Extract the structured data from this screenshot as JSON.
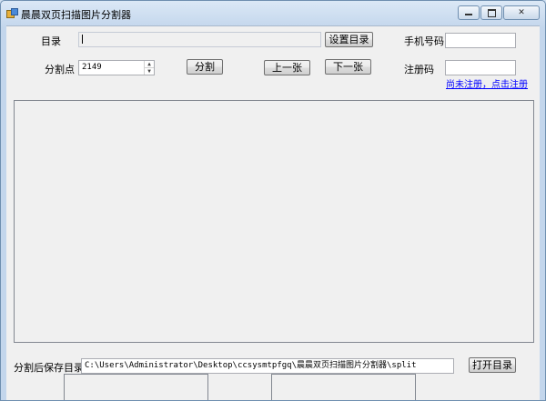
{
  "window": {
    "title": "晨晨双页扫描图片分割器"
  },
  "icons": {
    "app": "app-icon",
    "minimize": "minimize-icon",
    "maximize": "maximize-icon",
    "close": "close-icon"
  },
  "directory": {
    "label": "目录",
    "value": "",
    "set_button": "设置目录"
  },
  "phone": {
    "label": "手机号码",
    "value": ""
  },
  "split_point": {
    "label": "分割点",
    "value": "2149"
  },
  "actions": {
    "split": "分割",
    "prev": "上一张",
    "next": "下一张"
  },
  "register": {
    "label": "注册码",
    "value": "",
    "link": "尚未注册，点击注册"
  },
  "output": {
    "label": "分割后保存目录:",
    "path": "C:\\Users\\Administrator\\Desktop\\ccsysmtpfgq\\晨晨双页扫描图片分割器\\split",
    "open_button": "打开目录"
  }
}
